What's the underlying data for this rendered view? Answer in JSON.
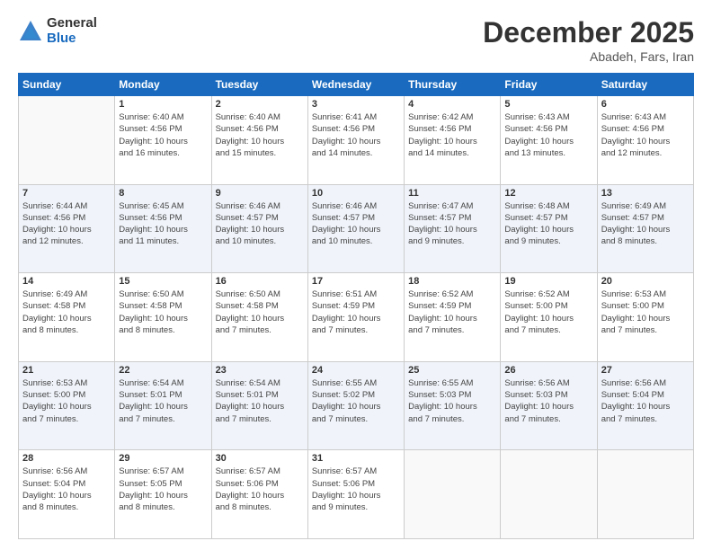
{
  "logo": {
    "general": "General",
    "blue": "Blue"
  },
  "header": {
    "month": "December 2025",
    "location": "Abadeh, Fars, Iran"
  },
  "weekdays": [
    "Sunday",
    "Monday",
    "Tuesday",
    "Wednesday",
    "Thursday",
    "Friday",
    "Saturday"
  ],
  "rows": [
    [
      {
        "num": "",
        "info": ""
      },
      {
        "num": "1",
        "info": "Sunrise: 6:40 AM\nSunset: 4:56 PM\nDaylight: 10 hours\nand 16 minutes."
      },
      {
        "num": "2",
        "info": "Sunrise: 6:40 AM\nSunset: 4:56 PM\nDaylight: 10 hours\nand 15 minutes."
      },
      {
        "num": "3",
        "info": "Sunrise: 6:41 AM\nSunset: 4:56 PM\nDaylight: 10 hours\nand 14 minutes."
      },
      {
        "num": "4",
        "info": "Sunrise: 6:42 AM\nSunset: 4:56 PM\nDaylight: 10 hours\nand 14 minutes."
      },
      {
        "num": "5",
        "info": "Sunrise: 6:43 AM\nSunset: 4:56 PM\nDaylight: 10 hours\nand 13 minutes."
      },
      {
        "num": "6",
        "info": "Sunrise: 6:43 AM\nSunset: 4:56 PM\nDaylight: 10 hours\nand 12 minutes."
      }
    ],
    [
      {
        "num": "7",
        "info": "Sunrise: 6:44 AM\nSunset: 4:56 PM\nDaylight: 10 hours\nand 12 minutes."
      },
      {
        "num": "8",
        "info": "Sunrise: 6:45 AM\nSunset: 4:56 PM\nDaylight: 10 hours\nand 11 minutes."
      },
      {
        "num": "9",
        "info": "Sunrise: 6:46 AM\nSunset: 4:57 PM\nDaylight: 10 hours\nand 10 minutes."
      },
      {
        "num": "10",
        "info": "Sunrise: 6:46 AM\nSunset: 4:57 PM\nDaylight: 10 hours\nand 10 minutes."
      },
      {
        "num": "11",
        "info": "Sunrise: 6:47 AM\nSunset: 4:57 PM\nDaylight: 10 hours\nand 9 minutes."
      },
      {
        "num": "12",
        "info": "Sunrise: 6:48 AM\nSunset: 4:57 PM\nDaylight: 10 hours\nand 9 minutes."
      },
      {
        "num": "13",
        "info": "Sunrise: 6:49 AM\nSunset: 4:57 PM\nDaylight: 10 hours\nand 8 minutes."
      }
    ],
    [
      {
        "num": "14",
        "info": "Sunrise: 6:49 AM\nSunset: 4:58 PM\nDaylight: 10 hours\nand 8 minutes."
      },
      {
        "num": "15",
        "info": "Sunrise: 6:50 AM\nSunset: 4:58 PM\nDaylight: 10 hours\nand 8 minutes."
      },
      {
        "num": "16",
        "info": "Sunrise: 6:50 AM\nSunset: 4:58 PM\nDaylight: 10 hours\nand 7 minutes."
      },
      {
        "num": "17",
        "info": "Sunrise: 6:51 AM\nSunset: 4:59 PM\nDaylight: 10 hours\nand 7 minutes."
      },
      {
        "num": "18",
        "info": "Sunrise: 6:52 AM\nSunset: 4:59 PM\nDaylight: 10 hours\nand 7 minutes."
      },
      {
        "num": "19",
        "info": "Sunrise: 6:52 AM\nSunset: 5:00 PM\nDaylight: 10 hours\nand 7 minutes."
      },
      {
        "num": "20",
        "info": "Sunrise: 6:53 AM\nSunset: 5:00 PM\nDaylight: 10 hours\nand 7 minutes."
      }
    ],
    [
      {
        "num": "21",
        "info": "Sunrise: 6:53 AM\nSunset: 5:00 PM\nDaylight: 10 hours\nand 7 minutes."
      },
      {
        "num": "22",
        "info": "Sunrise: 6:54 AM\nSunset: 5:01 PM\nDaylight: 10 hours\nand 7 minutes."
      },
      {
        "num": "23",
        "info": "Sunrise: 6:54 AM\nSunset: 5:01 PM\nDaylight: 10 hours\nand 7 minutes."
      },
      {
        "num": "24",
        "info": "Sunrise: 6:55 AM\nSunset: 5:02 PM\nDaylight: 10 hours\nand 7 minutes."
      },
      {
        "num": "25",
        "info": "Sunrise: 6:55 AM\nSunset: 5:03 PM\nDaylight: 10 hours\nand 7 minutes."
      },
      {
        "num": "26",
        "info": "Sunrise: 6:56 AM\nSunset: 5:03 PM\nDaylight: 10 hours\nand 7 minutes."
      },
      {
        "num": "27",
        "info": "Sunrise: 6:56 AM\nSunset: 5:04 PM\nDaylight: 10 hours\nand 7 minutes."
      }
    ],
    [
      {
        "num": "28",
        "info": "Sunrise: 6:56 AM\nSunset: 5:04 PM\nDaylight: 10 hours\nand 8 minutes."
      },
      {
        "num": "29",
        "info": "Sunrise: 6:57 AM\nSunset: 5:05 PM\nDaylight: 10 hours\nand 8 minutes."
      },
      {
        "num": "30",
        "info": "Sunrise: 6:57 AM\nSunset: 5:06 PM\nDaylight: 10 hours\nand 8 minutes."
      },
      {
        "num": "31",
        "info": "Sunrise: 6:57 AM\nSunset: 5:06 PM\nDaylight: 10 hours\nand 9 minutes."
      },
      {
        "num": "",
        "info": ""
      },
      {
        "num": "",
        "info": ""
      },
      {
        "num": "",
        "info": ""
      }
    ]
  ]
}
